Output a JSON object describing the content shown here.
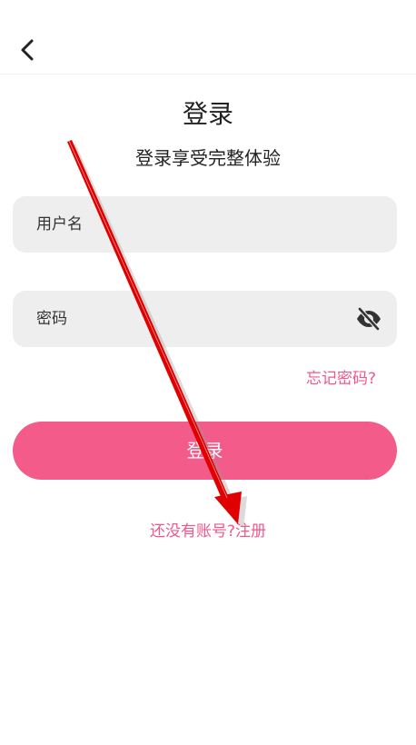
{
  "header": {
    "back_icon": "chevron-left-icon"
  },
  "login": {
    "title": "登录",
    "subtitle": "登录享受完整体验",
    "username_placeholder": "用户名",
    "password_placeholder": "密码",
    "password_toggle_icon": "eye-off-icon",
    "forgot_password": "忘记密码?",
    "login_button": "登录",
    "no_account_text": "还没有账号?",
    "register_link": "注册"
  },
  "colors": {
    "accent": "#f35b8a",
    "link": "#f0588a",
    "field_bg": "#eeeeee",
    "annotation_arrow": "#e00000"
  }
}
